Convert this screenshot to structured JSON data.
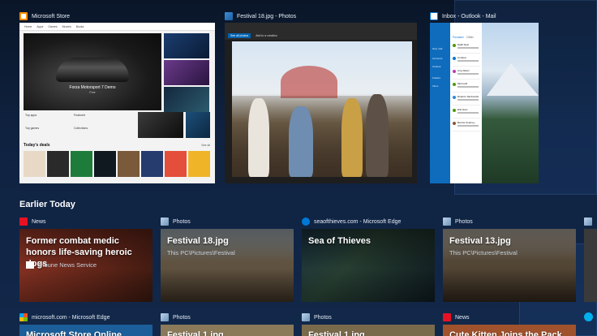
{
  "open_windows": [
    {
      "id": "store",
      "title": "Microsoft Store",
      "icon": "store-icon"
    },
    {
      "id": "photos",
      "title": "Festival 18.jpg - Photos",
      "icon": "photos-icon"
    },
    {
      "id": "mail",
      "title": "Inbox - Outlook - Mail",
      "icon": "mail-icon"
    }
  ],
  "store": {
    "nav": [
      "Home",
      "Apps",
      "Games",
      "Movies",
      "Books"
    ],
    "hero_title": "Forza Motorsport 7 Demo",
    "hero_sub": "Free",
    "links": [
      "Top apps",
      "Featured",
      "Top games",
      "Collections"
    ],
    "deals_title": "Today's deals",
    "see_all": "See all"
  },
  "photos": {
    "toolbar_see_all": "See all photos",
    "toolbar_add": "Add to a creation"
  },
  "mail": {
    "nav_items": [
      "New mail",
      "Accounts",
      "Outlook",
      "Folders",
      "Inbox"
    ],
    "list_tabs": [
      "Focused",
      "Other"
    ],
    "senders": [
      "Nabil Seal",
      "Cortana",
      "Amy Albert",
      "Microsoft",
      "Roberto Tamburello",
      "Erik Ham",
      "Bonnie Kearney"
    ]
  },
  "section": {
    "title": "Earlier Today"
  },
  "cards": [
    {
      "app": "News",
      "title": "Former combat medic honors life-saving heroic dogs",
      "sub": "Tribune News Service"
    },
    {
      "app": "Photos",
      "title": "Festival 18.jpg",
      "sub": "This PC\\Pictures\\Festival"
    },
    {
      "app": "seaofthieves.com - Microsoft Edge",
      "title": "Sea of Thieves",
      "sub": ""
    },
    {
      "app": "Photos",
      "title": "Festival 13.jpg",
      "sub": "This PC\\Pictures\\Festival"
    }
  ],
  "cards_row2": [
    {
      "app": "microsoft.com - Microsoft Edge",
      "title": "Microsoft Store Online"
    },
    {
      "app": "Photos",
      "title": "Festival 1.jpg"
    },
    {
      "app": "Photos",
      "title": "Festival 1.jpg"
    },
    {
      "app": "News",
      "title": "Cute Kitten Joins the Pack of"
    }
  ],
  "colors": {
    "accent": "#0078d7",
    "news": "#e81123",
    "edge": "#0078d7",
    "desktop": "#0f2240"
  }
}
